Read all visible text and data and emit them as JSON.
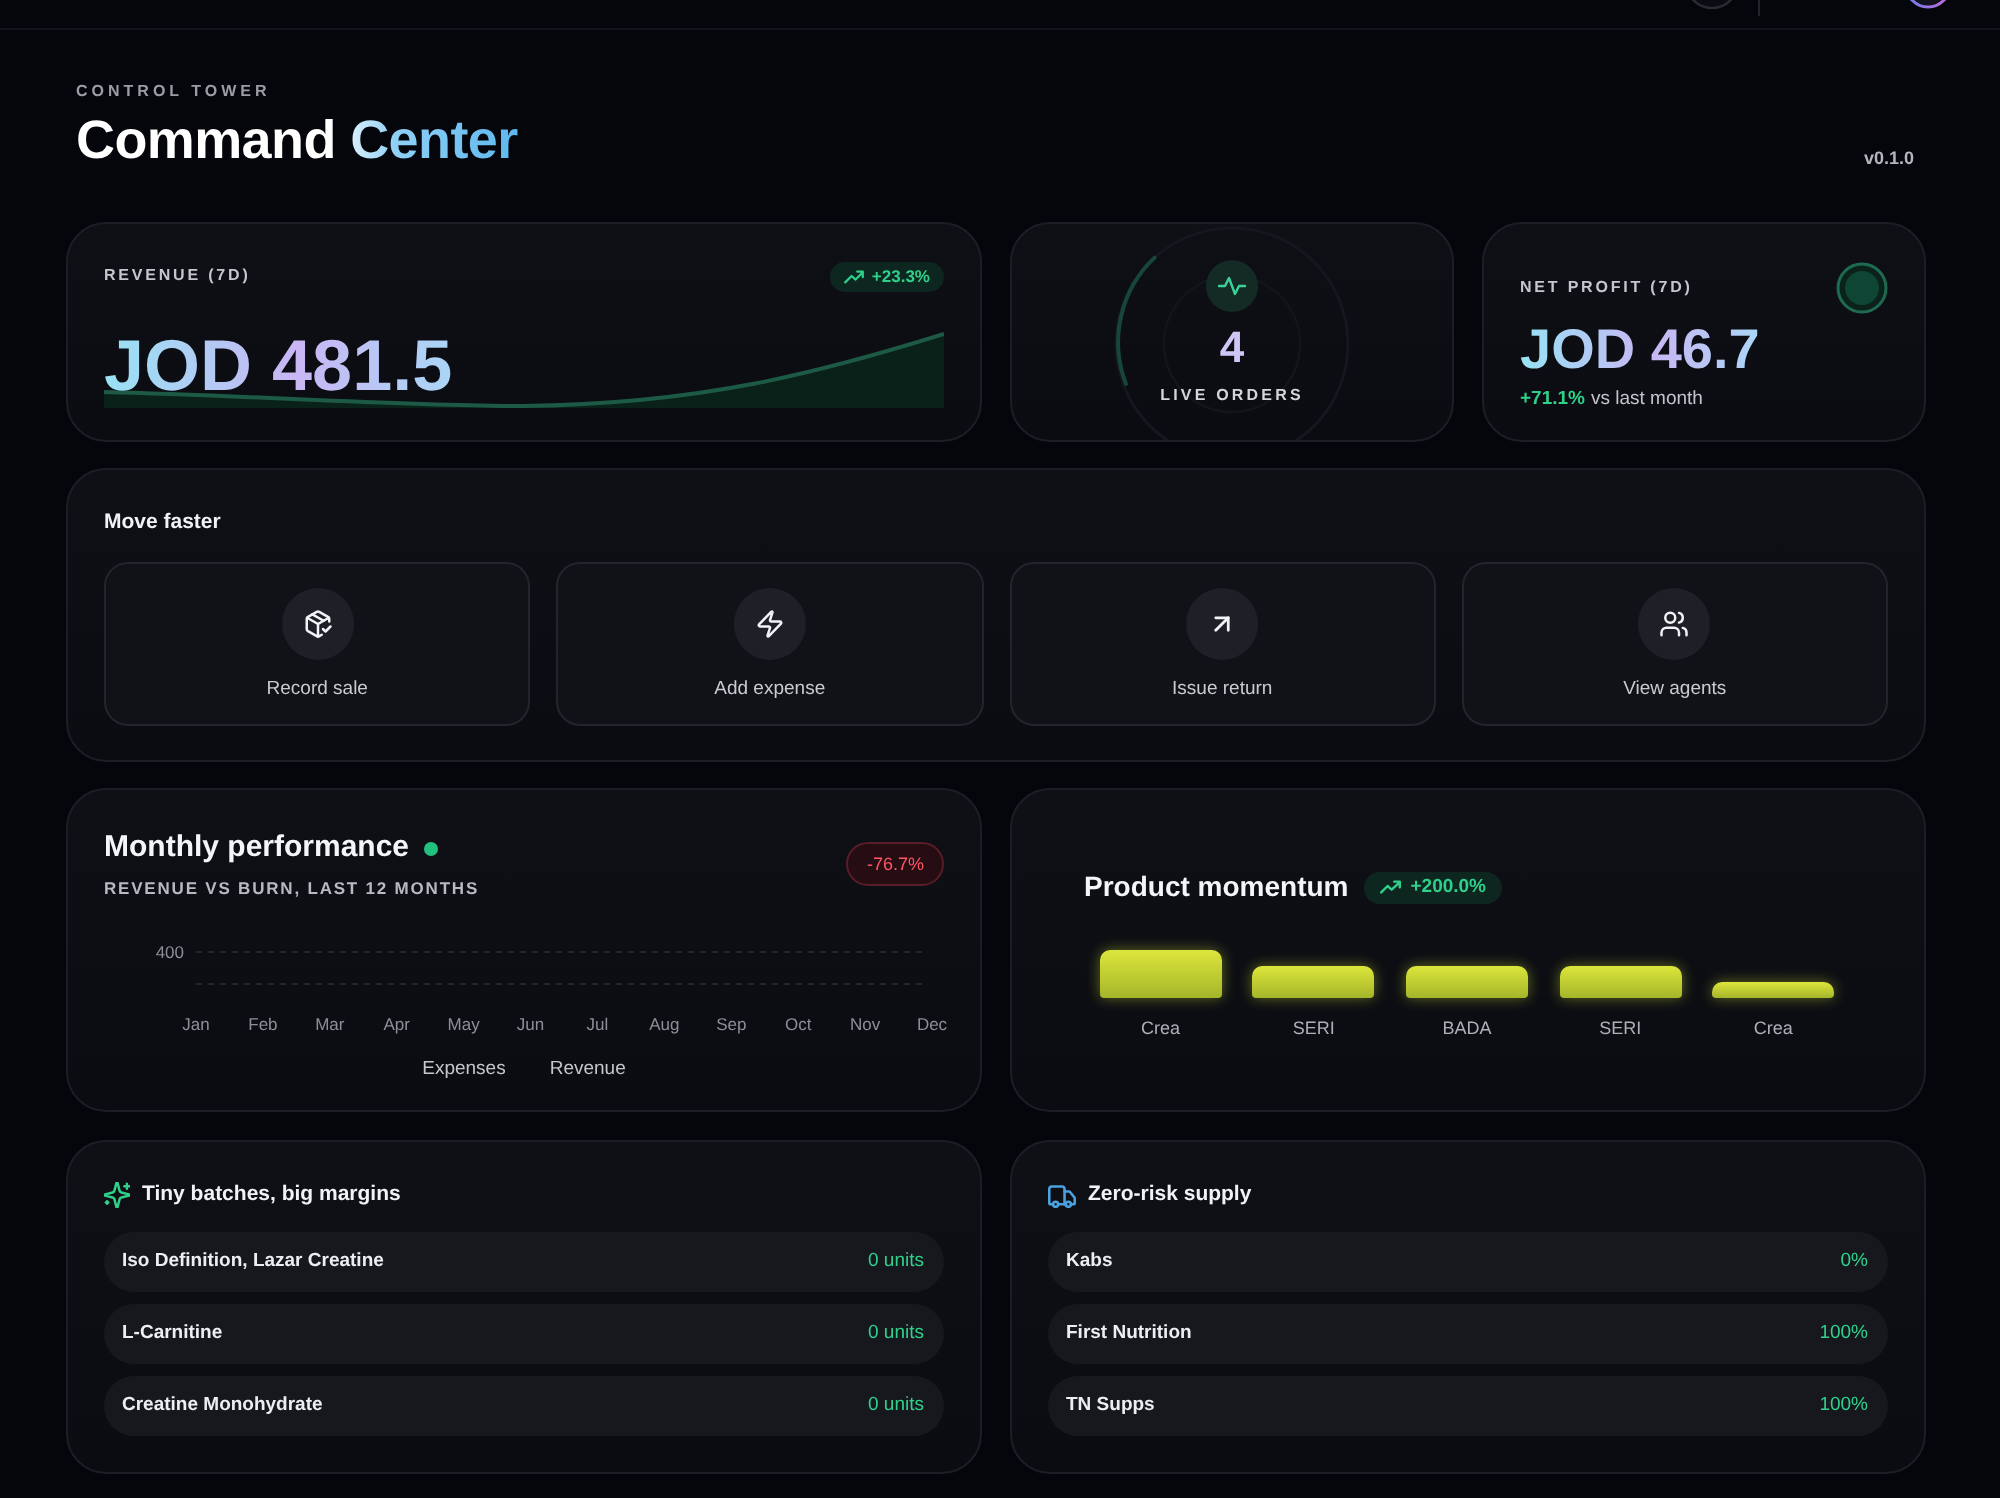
{
  "header": {
    "eyebrow": "CONTROL TOWER",
    "title": "Command Center",
    "version": "v0.1.0"
  },
  "revenue": {
    "label": "REVENUE (7D)",
    "change": "+23.3%",
    "value": "JOD 481.5"
  },
  "live_orders": {
    "count": "4",
    "label": "LIVE ORDERS"
  },
  "net_profit": {
    "label": "NET PROFIT (7D)",
    "value": "JOD 46.7",
    "change": "+71.1%",
    "comparison": "vs last month"
  },
  "quick_actions": {
    "title": "Move faster",
    "actions": [
      "Record sale",
      "Add expense",
      "Issue return",
      "View agents"
    ]
  },
  "monthly_performance": {
    "title": "Monthly performance",
    "subtitle": "REVENUE VS BURN, LAST 12 MONTHS",
    "change": "-76.7%",
    "chart": {
      "tick_label": "400",
      "months": [
        "Jan",
        "Feb",
        "Mar",
        "Apr",
        "May",
        "Jun",
        "Jul",
        "Aug",
        "Sep",
        "Oct",
        "Nov",
        "Dec"
      ],
      "legend": [
        "Expenses",
        "Revenue"
      ]
    }
  },
  "product_momentum": {
    "title": "Product momentum",
    "change": "+200.0%",
    "products": [
      "Crea",
      "SERI",
      "BADA",
      "SERI",
      "Crea"
    ]
  },
  "tiny_batches": {
    "title": "Tiny batches, big margins",
    "items": [
      {
        "name": "Iso Definition, Lazar Creatine",
        "value": "0 units"
      },
      {
        "name": "L-Carnitine",
        "value": "0 units"
      },
      {
        "name": "Creatine Monohydrate",
        "value": "0 units"
      }
    ]
  },
  "supply": {
    "title": "Zero-risk supply",
    "items": [
      {
        "name": "Kabs",
        "value": "0%"
      },
      {
        "name": "First Nutrition",
        "value": "100%"
      },
      {
        "name": "TN Supps",
        "value": "100%"
      }
    ]
  }
}
